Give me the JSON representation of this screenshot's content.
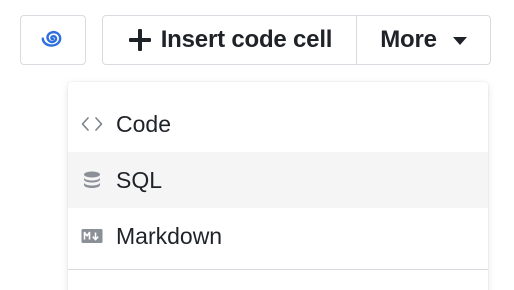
{
  "toolbar": {
    "logo_icon": "swirl-logo-icon",
    "insert_label": "Insert code cell",
    "insert_icon": "plus-icon",
    "more_label": "More",
    "more_icon": "caret-down-icon"
  },
  "menu": {
    "items": [
      {
        "label": "Code",
        "icon": "code-brackets-icon"
      },
      {
        "label": "SQL",
        "icon": "database-icon"
      },
      {
        "label": "Markdown",
        "icon": "markdown-icon"
      }
    ],
    "highlighted_item": "SQL"
  },
  "colors": {
    "logo_accent": "#2f6fe0",
    "text": "#1f2328",
    "border": "#d8dbe0",
    "highlight": "#f5f5f5",
    "icon_gray": "#8a8f98"
  }
}
